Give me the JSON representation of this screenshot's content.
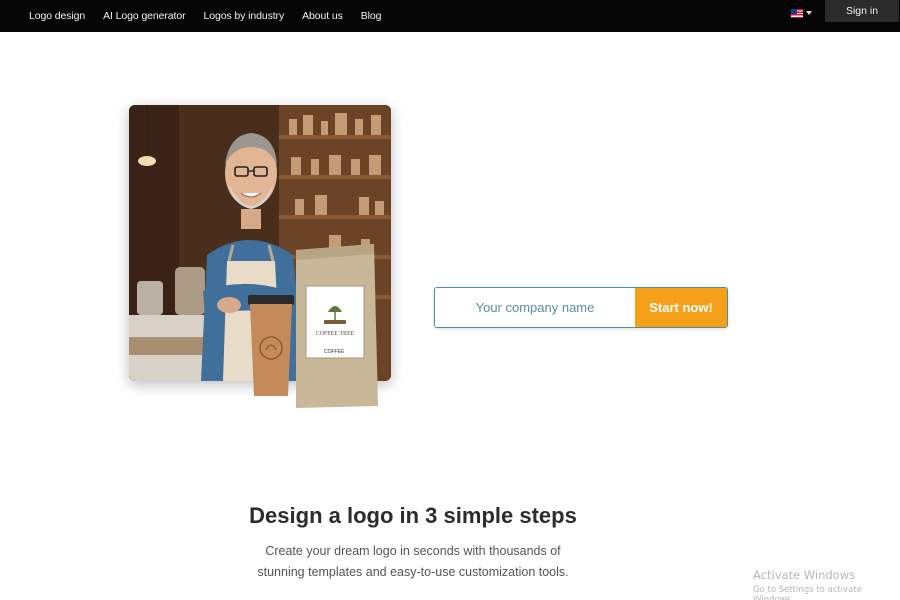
{
  "nav": {
    "items": [
      {
        "label": "Logo design"
      },
      {
        "label": "AI Logo generator"
      },
      {
        "label": "Logos by industry"
      },
      {
        "label": "About us"
      },
      {
        "label": "Blog"
      }
    ],
    "language_icon": "us-flag-icon",
    "signin_label": "Sign in"
  },
  "hero": {
    "bag_label": "COFFEE TREE",
    "bag_sublabel": "COFFEE",
    "company_placeholder": "Your company name",
    "start_label": "Start now!",
    "accent_color": "#f6a01a"
  },
  "steps": {
    "title": "Design a logo in 3 simple steps",
    "subtitle": "Create your dream logo in seconds with thousands of stunning templates and easy-to-use customization tools."
  },
  "watermark": {
    "title": "Activate Windows",
    "subtitle": "Go to Settings to activate Windows."
  }
}
